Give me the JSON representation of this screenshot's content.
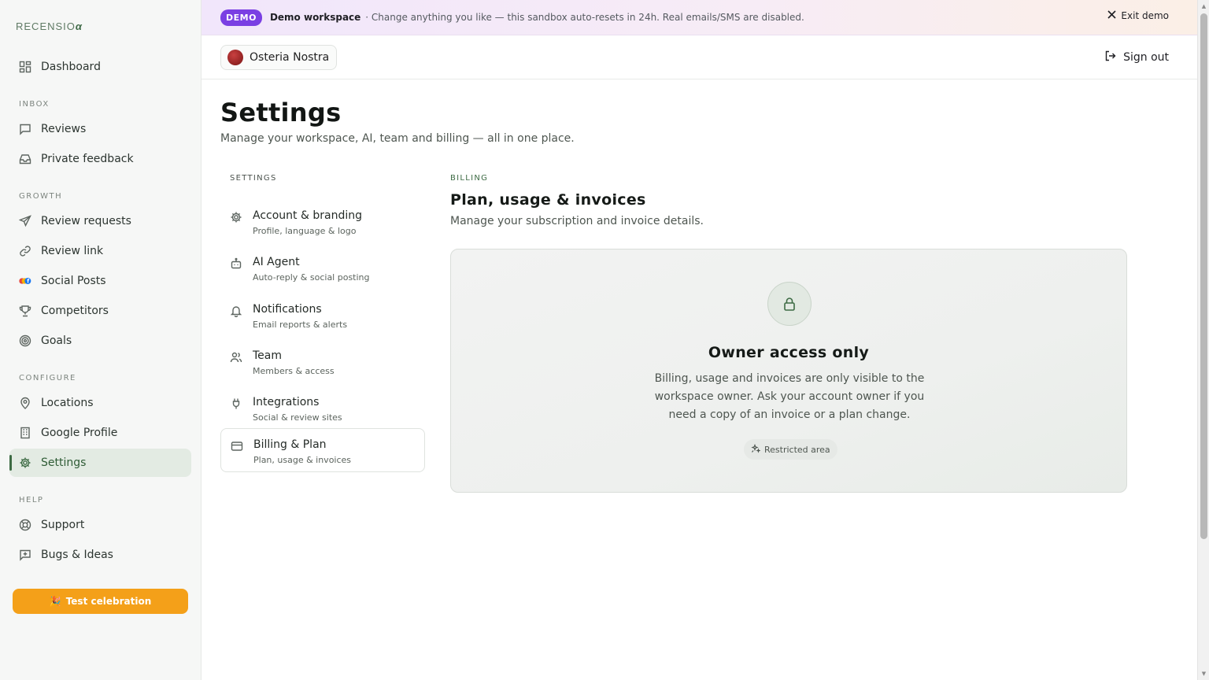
{
  "brand": {
    "name": "RECENSIO",
    "mark": "α"
  },
  "sidebar": {
    "items": {
      "dashboard": "Dashboard",
      "reviews": "Reviews",
      "private_feedback": "Private feedback",
      "review_requests": "Review requests",
      "review_link": "Review link",
      "social_posts": "Social Posts",
      "competitors": "Competitors",
      "goals": "Goals",
      "locations": "Locations",
      "google_profile": "Google Profile",
      "settings": "Settings",
      "support": "Support",
      "bugs_ideas": "Bugs & Ideas"
    },
    "sections": {
      "inbox": "INBOX",
      "growth": "GROWTH",
      "configure": "CONFIGURE",
      "help": "HELP"
    },
    "active": "settings",
    "celebrate_label": "Test celebration",
    "celebrate_emoji": "🎉"
  },
  "banner": {
    "pill": "DEMO",
    "workspace": "Demo workspace",
    "message": "· Change anything you like — this sandbox auto-resets in 24h. Real emails/SMS are disabled.",
    "exit_label": "Exit demo"
  },
  "topbar": {
    "location_name": "Osteria Nostra",
    "signout_label": "Sign out"
  },
  "page": {
    "title": "Settings",
    "subtitle": "Manage your workspace, AI, team and billing — all in one place."
  },
  "settings_nav": {
    "heading": "SETTINGS",
    "items": [
      {
        "title": "Account & branding",
        "sub": "Profile, language & logo"
      },
      {
        "title": "AI Agent",
        "sub": "Auto-reply & social posting"
      },
      {
        "title": "Notifications",
        "sub": "Email reports & alerts"
      },
      {
        "title": "Team",
        "sub": "Members & access"
      },
      {
        "title": "Integrations",
        "sub": "Social & review sites"
      },
      {
        "title": "Billing & Plan",
        "sub": "Plan, usage & invoices"
      }
    ],
    "active_index": 5
  },
  "section": {
    "eyebrow": "BILLING",
    "title": "Plan, usage & invoices",
    "subtitle": "Manage your subscription and invoice details.",
    "card": {
      "title": "Owner access only",
      "body": "Billing, usage and invoices are only visible to the workspace owner. Ask your account owner if you need a copy of an invoice or a plan change.",
      "badge": "Restricted area",
      "icon": "lock-icon"
    }
  },
  "colors": {
    "accent": "#3d6b44",
    "demo": "#7a3fe3",
    "celebrate": "#f4a019"
  }
}
